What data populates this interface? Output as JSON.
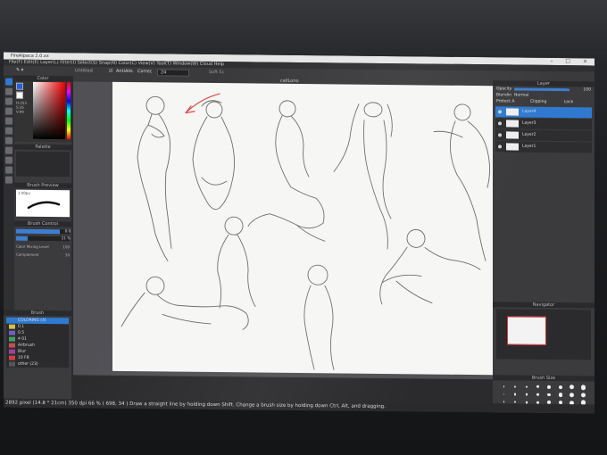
{
  "window": {
    "title": "FireAlpaca 2.0.xx"
  },
  "menubar": {
    "text": "File(F)  Edit(E)  Layer(L)  Filter(I)  Select(S)  Snap(N)  Color(C)  View(V)  Tool(T)  Window(W)  Cloud  Help"
  },
  "toolbar": {
    "document_name": "Untitled",
    "antialias_label": "AntiAlis",
    "correction_label": "Correc",
    "correction_value": "24",
    "soft_edge_label": "Soft Ec"
  },
  "color_panel": {
    "title": "Color",
    "hsv_text": [
      "H:255",
      "S:35",
      "V:99"
    ],
    "color_primary": "#2060e0",
    "color_secondary": "#ffffff"
  },
  "palette_panel": {
    "title": "Palette"
  },
  "brush_preview": {
    "title": "Brush Preview",
    "label": "1.00px"
  },
  "brush_control": {
    "title": "Brush Control",
    "size_value": "8.0",
    "opacity_value": "21 %",
    "color_mixing_label": "Color Mixing Level",
    "color_mixing_value": "100",
    "complement_label": "Complement",
    "complement_value": "30",
    "size_fraction": 0.82,
    "opacity_fraction": 0.21
  },
  "brush_panel": {
    "title": "Brush",
    "items": [
      {
        "label": "COLORING (4)",
        "color": "#2f7ad0",
        "selected": true
      },
      {
        "label": "0.1",
        "color": "#d0c050",
        "selected": false
      },
      {
        "label": "0.5",
        "color": "#7060c0",
        "selected": false
      },
      {
        "label": "4 01",
        "color": "#40a060",
        "selected": false
      },
      {
        "label": "Airbrush",
        "color": "#c05050",
        "selected": false
      },
      {
        "label": "Blur",
        "color": "#a040a0",
        "selected": false
      },
      {
        "label": "10  F8",
        "color": "#d04040",
        "selected": false
      },
      {
        "label": "other (23)",
        "color": "#555555",
        "selected": false
      }
    ]
  },
  "canvas": {
    "doc_tab": "callLono"
  },
  "layer_panel": {
    "title": "Layer",
    "opacity_label": "Opacity",
    "opacity_value": "100",
    "blending_label": "Blendin",
    "blending_value": "Normal",
    "protect_label": "Protect A",
    "clip_label": "Clipping",
    "lock_label": "Lock",
    "layers": [
      {
        "name": "Layer4",
        "selected": true
      },
      {
        "name": "Layer3",
        "selected": false
      },
      {
        "name": "Layer2",
        "selected": false
      },
      {
        "name": "Layer1",
        "selected": false
      }
    ]
  },
  "navigator": {
    "title": "Navigator"
  },
  "brush_size": {
    "title": "Brush Size"
  },
  "statusbar": {
    "text": "2892 pixel  (14.8 * 21cm)  350 dpi  66 %  ( 698, 34 )  Draw a straight line by holding down Shift. Change a brush size by holding down Ctrl, Alt, and dragging."
  }
}
